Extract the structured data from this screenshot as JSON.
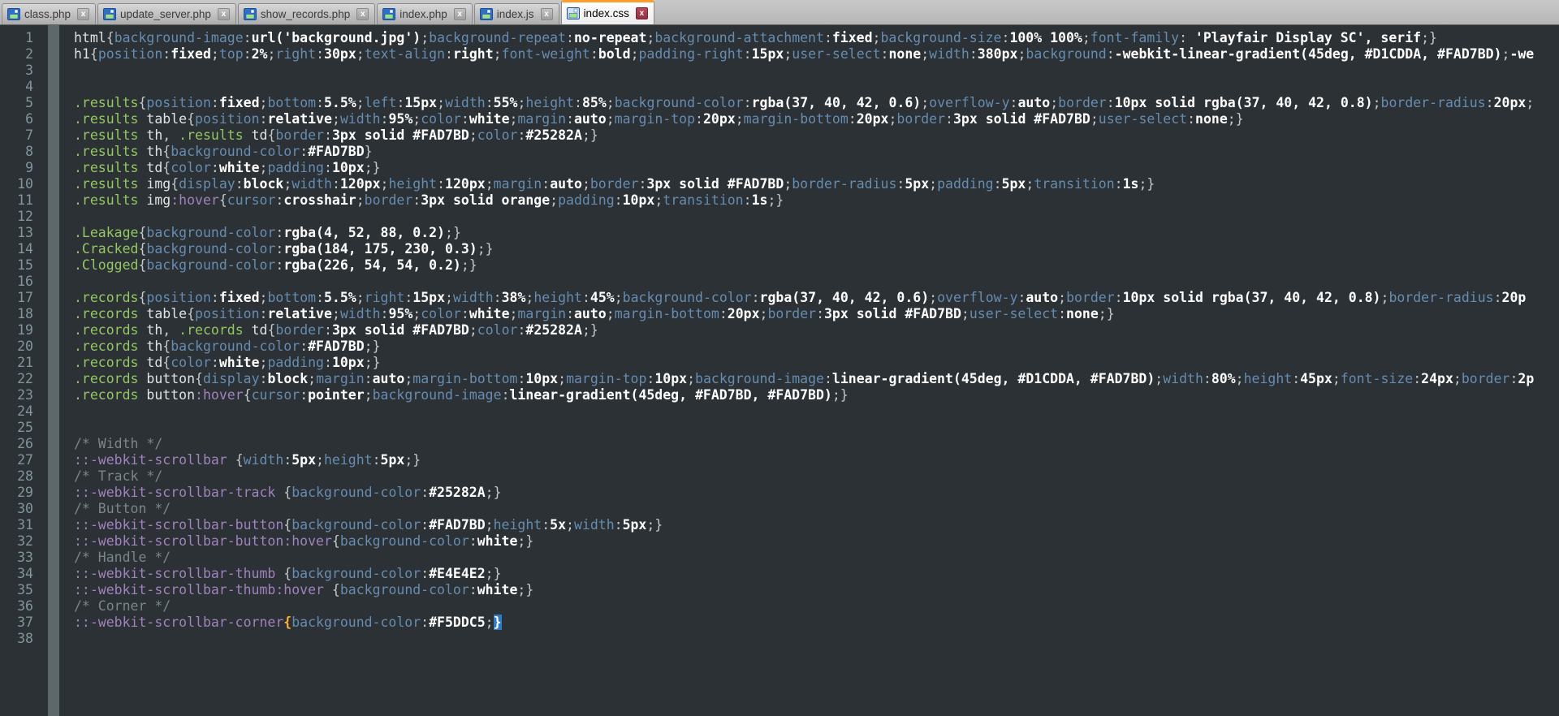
{
  "tabs": [
    {
      "label": "class.php",
      "active": false
    },
    {
      "label": "update_server.php",
      "active": false
    },
    {
      "label": "show_records.php",
      "active": false
    },
    {
      "label": "index.php",
      "active": false
    },
    {
      "label": "index.js",
      "active": false
    },
    {
      "label": "index.css",
      "active": true
    }
  ],
  "tab_icons": {
    "saved_icon": "floppy-disk-icon",
    "close_label": "x"
  },
  "editor": {
    "brace_match_line": 37,
    "colors": {
      "background": "#2B3134",
      "line_number": "#81969F",
      "fold_margin": "#5D686B",
      "comment": "#7A868C",
      "class_selector": "#93C763",
      "pseudo_selector": "#A082BD",
      "property": "#678CB1",
      "value": "#FFFFFF",
      "active_tab_accent": "#FF9C2A",
      "active_close_button": "#96303F",
      "matched_open_brace": "#FFB129",
      "matched_close_brace_bg": "#2E7BC4"
    },
    "lines": [
      "html{background-image:url('background.jpg');background-repeat:no-repeat;background-attachment:fixed;background-size:100% 100%;font-family: 'Playfair Display SC', serif;}",
      "h1{position:fixed;top:2%;right:30px;text-align:right;font-weight:bold;padding-right:15px;user-select:none;width:380px;background:-webkit-linear-gradient(45deg, #D1CDDA, #FAD7BD);-we",
      "",
      "",
      ".results{position:fixed;bottom:5.5%;left:15px;width:55%;height:85%;background-color:rgba(37, 40, 42, 0.6);overflow-y:auto;border:10px solid rgba(37, 40, 42, 0.8);border-radius:20px;",
      ".results table{position:relative;width:95%;color:white;margin:auto;margin-top:20px;margin-bottom:20px;border:3px solid #FAD7BD;user-select:none;}",
      ".results th, .results td{border:3px solid #FAD7BD;color:#25282A;}",
      ".results th{background-color:#FAD7BD}",
      ".results td{color:white;padding:10px;}",
      ".results img{display:block;width:120px;height:120px;margin:auto;border:3px solid #FAD7BD;border-radius:5px;padding:5px;transition:1s;}",
      ".results img:hover{cursor:crosshair;border:3px solid orange;padding:10px;transition:1s;}",
      "",
      ".Leakage{background-color:rgba(4, 52, 88, 0.2);}",
      ".Cracked{background-color:rgba(184, 175, 230, 0.3);}",
      ".Clogged{background-color:rgba(226, 54, 54, 0.2);}",
      "",
      ".records{position:fixed;bottom:5.5%;right:15px;width:38%;height:45%;background-color:rgba(37, 40, 42, 0.6);overflow-y:auto;border:10px solid rgba(37, 40, 42, 0.8);border-radius:20p",
      ".records table{position:relative;width:95%;color:white;margin:auto;margin-bottom:20px;border:3px solid #FAD7BD;user-select:none;}",
      ".records th, .records td{border:3px solid #FAD7BD;color:#25282A;}",
      ".records th{background-color:#FAD7BD;}",
      ".records td{color:white;padding:10px;}",
      ".records button{display:block;margin:auto;margin-bottom:10px;margin-top:10px;background-image:linear-gradient(45deg, #D1CDDA, #FAD7BD);width:80%;height:45px;font-size:24px;border:2p",
      ".records button:hover{cursor:pointer;background-image:linear-gradient(45deg, #FAD7BD, #FAD7BD);}",
      "",
      "",
      "/* Width */",
      "::-webkit-scrollbar {width:5px;height:5px;}",
      "/* Track */",
      "::-webkit-scrollbar-track {background-color:#25282A;}",
      "/* Button */",
      "::-webkit-scrollbar-button{background-color:#FAD7BD;height:5x;width:5px;}",
      "::-webkit-scrollbar-button:hover{background-color:white;}",
      "/* Handle */",
      "::-webkit-scrollbar-thumb {background-color:#E4E4E2;}",
      "::-webkit-scrollbar-thumb:hover {background-color:white;}",
      "/* Corner */",
      "::-webkit-scrollbar-corner{background-color:#F5DDC5;}",
      ""
    ]
  }
}
